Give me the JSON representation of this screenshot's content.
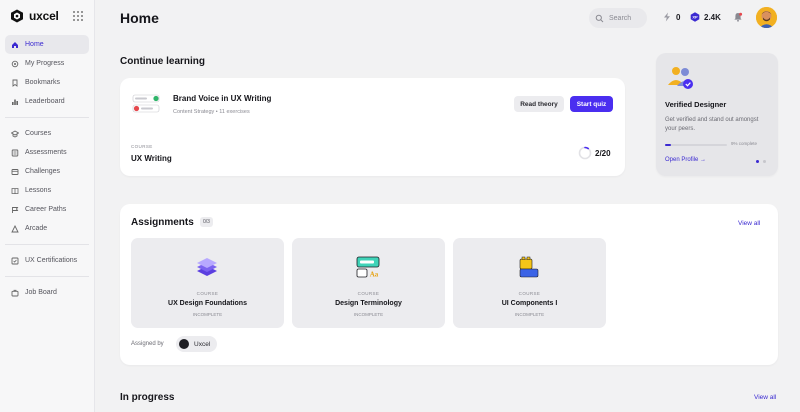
{
  "brand": {
    "name": "uxcel",
    "icon": "uxcel-logo-icon"
  },
  "sidebar": {
    "groups": [
      [
        {
          "label": "Home",
          "icon": "home-icon",
          "active": true
        },
        {
          "label": "My Progress",
          "icon": "progress-icon"
        },
        {
          "label": "Bookmarks",
          "icon": "bookmark-icon"
        },
        {
          "label": "Leaderboard",
          "icon": "leaderboard-icon"
        }
      ],
      [
        {
          "label": "Courses",
          "icon": "courses-icon"
        },
        {
          "label": "Assessments",
          "icon": "assessments-icon"
        },
        {
          "label": "Challenges",
          "icon": "challenges-icon"
        },
        {
          "label": "Lessons",
          "icon": "lessons-icon"
        },
        {
          "label": "Career Paths",
          "icon": "career-paths-icon"
        },
        {
          "label": "Arcade",
          "icon": "arcade-icon"
        }
      ],
      [
        {
          "label": "UX Certifications",
          "icon": "certification-icon"
        }
      ],
      [
        {
          "label": "Job Board",
          "icon": "job-board-icon"
        }
      ]
    ]
  },
  "header": {
    "title": "Home",
    "search_placeholder": "Search",
    "streak": "0",
    "points": "2.4K"
  },
  "continue_learning": {
    "title": "Continue learning",
    "lesson_title": "Brand Voice in UX Writing",
    "lesson_meta": "Content Strategy  •  11 exercises",
    "read_label": "Read theory",
    "start_label": "Start quiz",
    "course_kicker": "COURSE",
    "course_name": "UX Writing",
    "progress_text": "2/20",
    "progress_fraction": 0.1
  },
  "promo": {
    "title": "Verified Designer",
    "description": "Get verified and stand out amongst your peers.",
    "percent_label": "9% complete",
    "percent": 9,
    "link": "Open Profile →"
  },
  "assignments": {
    "title": "Assignments",
    "count": "0/3",
    "view_all": "View all",
    "tiles": [
      {
        "kicker": "COURSE",
        "name": "UX Design Foundations",
        "status": "INCOMPLETE",
        "icon": "layers-icon"
      },
      {
        "kicker": "COURSE",
        "name": "Design Terminology",
        "status": "INCOMPLETE",
        "icon": "typography-icon"
      },
      {
        "kicker": "COURSE",
        "name": "UI Components I",
        "status": "INCOMPLETE",
        "icon": "blocks-icon"
      }
    ],
    "assigned_by_label": "Assigned by",
    "assigned_by": "Uxcel"
  },
  "in_progress": {
    "title": "In progress",
    "view_all": "View all"
  },
  "colors": {
    "accent": "#4a2ef0",
    "background": "#f2f2f3"
  }
}
